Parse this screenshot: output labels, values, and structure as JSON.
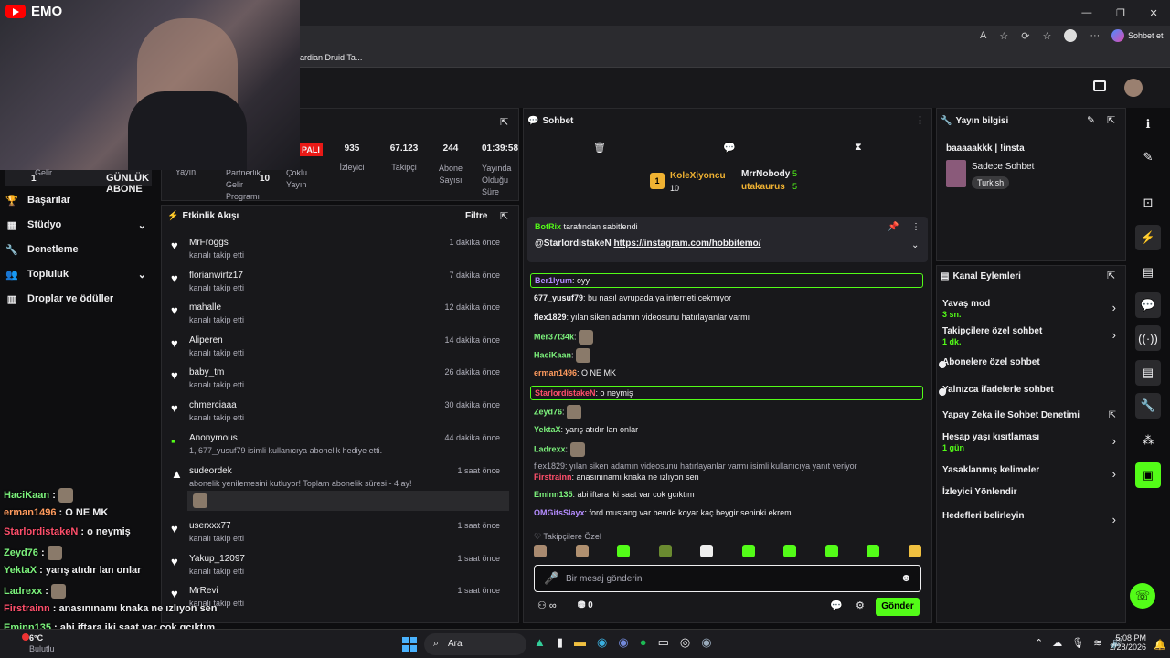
{
  "browser": {
    "sohbet_label": "Sohbet et",
    "bookmark": "ardian Druid Ta..."
  },
  "cam": {
    "logo": "EMO"
  },
  "stats": {
    "cevrimdisi": "PALI",
    "items": [
      {
        "value": "935",
        "label": "İzleyici"
      },
      {
        "value": "67.123",
        "label": "Takipçi"
      },
      {
        "value": "244",
        "label": "Abone Sayısı"
      },
      {
        "value": "01:39:58",
        "label": "Yayında Olduğu Süre"
      }
    ],
    "left_labels": [
      "Yayın",
      "Partnerlik Gelir Programı",
      "Çoklu Yayın"
    ],
    "gunluk": "GÜNLÜK ABONE",
    "gunluk_left": "1",
    "gunluk_right": "10",
    "gelir": "Gelir"
  },
  "sidebar": {
    "items": [
      {
        "label": "Başarılar",
        "icon": "trophy-icon"
      },
      {
        "label": "Stüdyo",
        "icon": "studio-icon",
        "chevron": true
      },
      {
        "label": "Denetleme",
        "icon": "wrench-icon"
      },
      {
        "label": "Topluluk",
        "icon": "people-icon",
        "chevron": true
      },
      {
        "label": "Droplar ve ödüller",
        "icon": "drops-icon"
      }
    ]
  },
  "activity": {
    "title": "Etkinlik Akışı",
    "filter": "Filtre",
    "rows": [
      {
        "name": "MrFroggs",
        "sub": "kanalı takip etti",
        "time": "1 dakika önce"
      },
      {
        "name": "florianwirtz17",
        "sub": "kanalı takip etti",
        "time": "7 dakika önce"
      },
      {
        "name": "mahalle",
        "sub": "kanalı takip etti",
        "time": "12 dakika önce"
      },
      {
        "name": "Aliperen",
        "sub": "kanalı takip etti",
        "time": "14 dakika önce"
      },
      {
        "name": "baby_tm",
        "sub": "kanalı takip etti",
        "time": "26 dakika önce"
      },
      {
        "name": "chmerciaaa",
        "sub": "kanalı takip etti",
        "time": "30 dakika önce"
      }
    ],
    "gift": {
      "name": "Anonymous",
      "sub": "1, 677_yusuf79 isimli kullanıcıya abonelik hediye etti.",
      "time": "44 dakika önce"
    },
    "resub": {
      "name": "sudeordek",
      "sub": "abonelik yenilemesini kutluyor! Toplam abonelik süresi - 4 ay!",
      "time": "1 saat önce"
    },
    "rows2": [
      {
        "name": "userxxx77",
        "sub": "kanalı takip etti",
        "time": "1 saat önce"
      },
      {
        "name": "Yakup_12097",
        "sub": "kanalı takip etti",
        "time": "1 saat önce"
      },
      {
        "name": "MrRevi",
        "sub": "kanalı takip etti",
        "time": "1 saat önce"
      }
    ]
  },
  "chat": {
    "title": "Sohbet",
    "top": {
      "first": "KoleXiyoncu",
      "first_count": "10",
      "second": "MrrNobody",
      "second_count": "5",
      "third": "utakaurus",
      "third_count": "5"
    },
    "pinned_by": "BotRix",
    "pinned_suffix": "tarafından sabitlendi",
    "pinned_user": "@StarlordistakeN",
    "pinned_link": "https://instagram.com/hobbitemo/",
    "lines": [
      {
        "user": "Ber1lyum",
        "color": "#b48cff",
        "text": ": oyy",
        "boxed": true
      },
      {
        "user": "677_yusuf79",
        "color": "#efeff1",
        "text": ": bu nasıl avrupada ya interneti cekmıyor"
      },
      {
        "user": "flex1829",
        "color": "#efeff1",
        "text": ": yılan siken adamın videosunu hatırlayanlar varmı"
      },
      {
        "user": "Mer37t34k",
        "color": "#7cf27c",
        "text": ":",
        "emote": true
      },
      {
        "user": "HaciKaan",
        "color": "#7cf27c",
        "text": ":",
        "emote": true
      },
      {
        "user": "erman1496",
        "color": "#ff9b5e",
        "text": ": O NE MK"
      },
      {
        "user": "StarlordistakeN",
        "color": "#ff4f6b",
        "text": ": o neymiş",
        "boxed": true
      },
      {
        "user": "Zeyd76",
        "color": "#7cf27c",
        "text": ":",
        "emote": true
      },
      {
        "user": "YektaX",
        "color": "#7cf27c",
        "text": ": yarış atıdır lan onlar"
      },
      {
        "user": "Ladrexx",
        "color": "#7cf27c",
        "text": ":",
        "emote": true
      },
      {
        "user": "Firstrainn",
        "color": "#ff4f6b",
        "text": ": anasınınamı knaka ne ızlıyon sen",
        "reply": "flex1829: yılan siken adamın videosunu hatırlayanlar varmı isimli kullanıcıya yanıt veriyor"
      },
      {
        "user": "Eminn135",
        "color": "#7cf27c",
        "text": ": abi iftara iki saat var cok gcıktım"
      },
      {
        "user": "OMGitsSlayx",
        "color": "#b48cff",
        "text": ": ford mustang var bende koyar kaç beygir seninki ekrem"
      }
    ],
    "followers_only": "Takipçilere Özel",
    "input_placeholder": "Bir mesaj gönderin",
    "points": "0",
    "send": "Gönder"
  },
  "stream_info": {
    "title": "Yayın bilgisi",
    "stream_title": "baaaaakkk | !insta",
    "category": "Sadece Sohbet",
    "tag": "Turkish"
  },
  "channel_actions": {
    "title": "Kanal Eylemleri",
    "items": [
      {
        "label": "Yavaş mod",
        "sub": "3 sn.",
        "kind": "chevron"
      },
      {
        "label": "Takipçilere özel sohbet",
        "sub": "1 dk.",
        "kind": "chevron"
      },
      {
        "label": "Abonelere özel sohbet",
        "sub": "",
        "kind": "toggle"
      },
      {
        "label": "Yalnızca ifadelerle sohbet",
        "sub": "",
        "kind": "toggle"
      },
      {
        "label": "Yapay Zeka ile Sohbet Denetimi",
        "sub": "",
        "kind": "external"
      },
      {
        "label": "Hesap yaşı kısıtlaması",
        "sub": "1 gün",
        "kind": "chevron"
      },
      {
        "label": "Yasaklanmış kelimeler",
        "sub": "",
        "kind": "chevron"
      },
      {
        "label": "İzleyici Yönlendir",
        "sub": "",
        "kind": "none"
      },
      {
        "label": "Hedefleri belirleyin",
        "sub": "",
        "kind": "chevron"
      }
    ]
  },
  "overlay_chat": [
    {
      "user": "HaciKaan",
      "color": "#7cf27c",
      "text": " :",
      "emote": true
    },
    {
      "user": "erman1496",
      "color": "#ff9b5e",
      "text": " : O NE MK"
    },
    {
      "user": "StarlordistakeN",
      "color": "#ff4f6b",
      "text": " : o neymiş"
    },
    {
      "user": "Zeyd76",
      "color": "#7cf27c",
      "text": " :",
      "emote": true
    },
    {
      "user": "YektaX",
      "color": "#7cf27c",
      "text": " : yarış atıdır lan onlar"
    },
    {
      "user": "Ladrexx",
      "color": "#7cf27c",
      "text": " :",
      "emote": true
    },
    {
      "user": "Firstrainn",
      "color": "#ff4f6b",
      "text": " : anasınınamı knaka ne ızlıyon sen"
    },
    {
      "user": "Eminn135",
      "color": "#7cf27c",
      "text": " : abi iftara iki saat var cok gcıktım"
    }
  ],
  "taskbar": {
    "weather_temp": "6°C",
    "weather_desc": "Bulutlu",
    "search": "Ara",
    "time": "5:08 PM",
    "date": "2/28/2026"
  }
}
